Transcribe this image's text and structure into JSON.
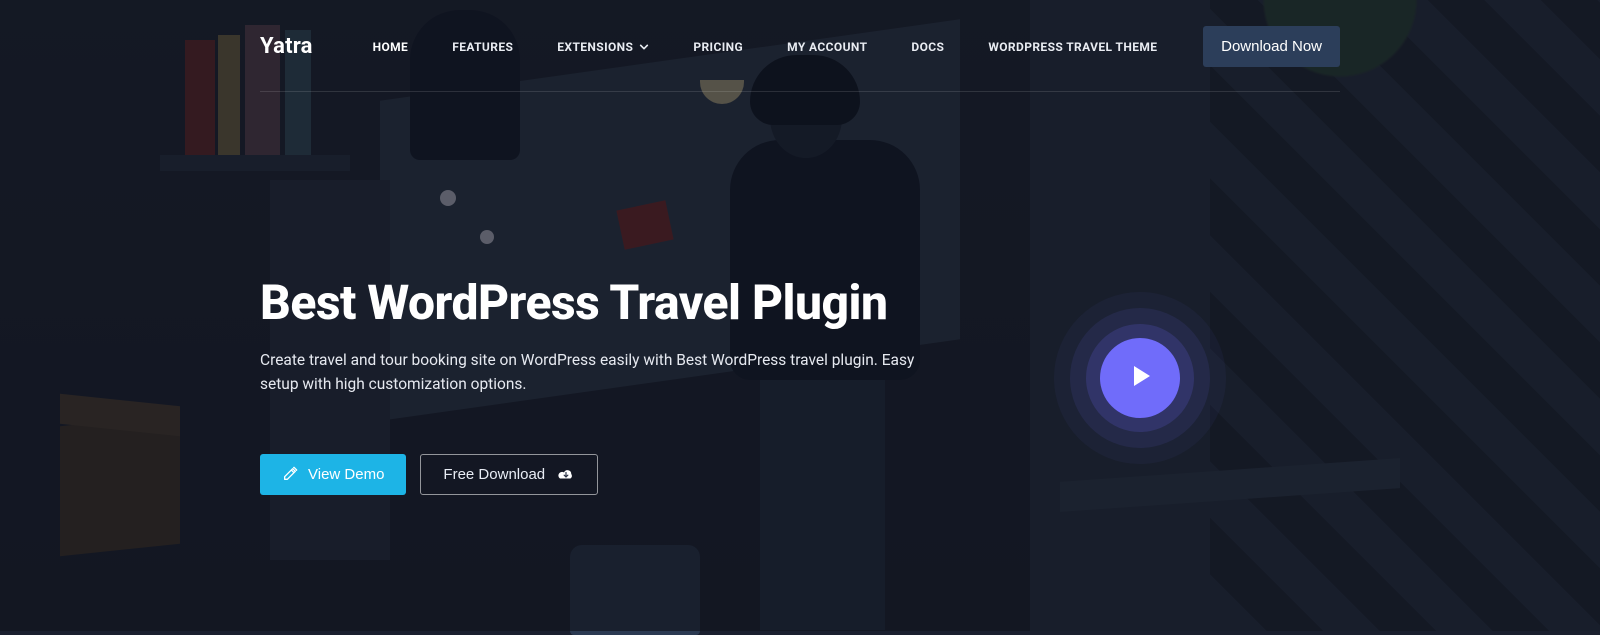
{
  "brand": {
    "name": "Yatra"
  },
  "nav": {
    "items": [
      {
        "label": "HOME"
      },
      {
        "label": "FEATURES"
      },
      {
        "label": "EXTENSIONS"
      },
      {
        "label": "PRICING"
      },
      {
        "label": "MY ACCOUNT"
      },
      {
        "label": "DOCS"
      },
      {
        "label": "WORDPRESS TRAVEL THEME"
      }
    ],
    "download_label": "Download Now"
  },
  "hero": {
    "title": "Best WordPress Travel Plugin",
    "subtitle": "Create travel and tour booking site on WordPress easily with Best WordPress travel plugin. Easy setup with high customization options.",
    "view_demo_label": "View Demo",
    "free_download_label": "Free Download"
  },
  "icons": {
    "chevron_down": "chevron-down-icon",
    "edit": "edit-icon",
    "cloud_download": "cloud-download-icon",
    "play": "play-icon"
  }
}
